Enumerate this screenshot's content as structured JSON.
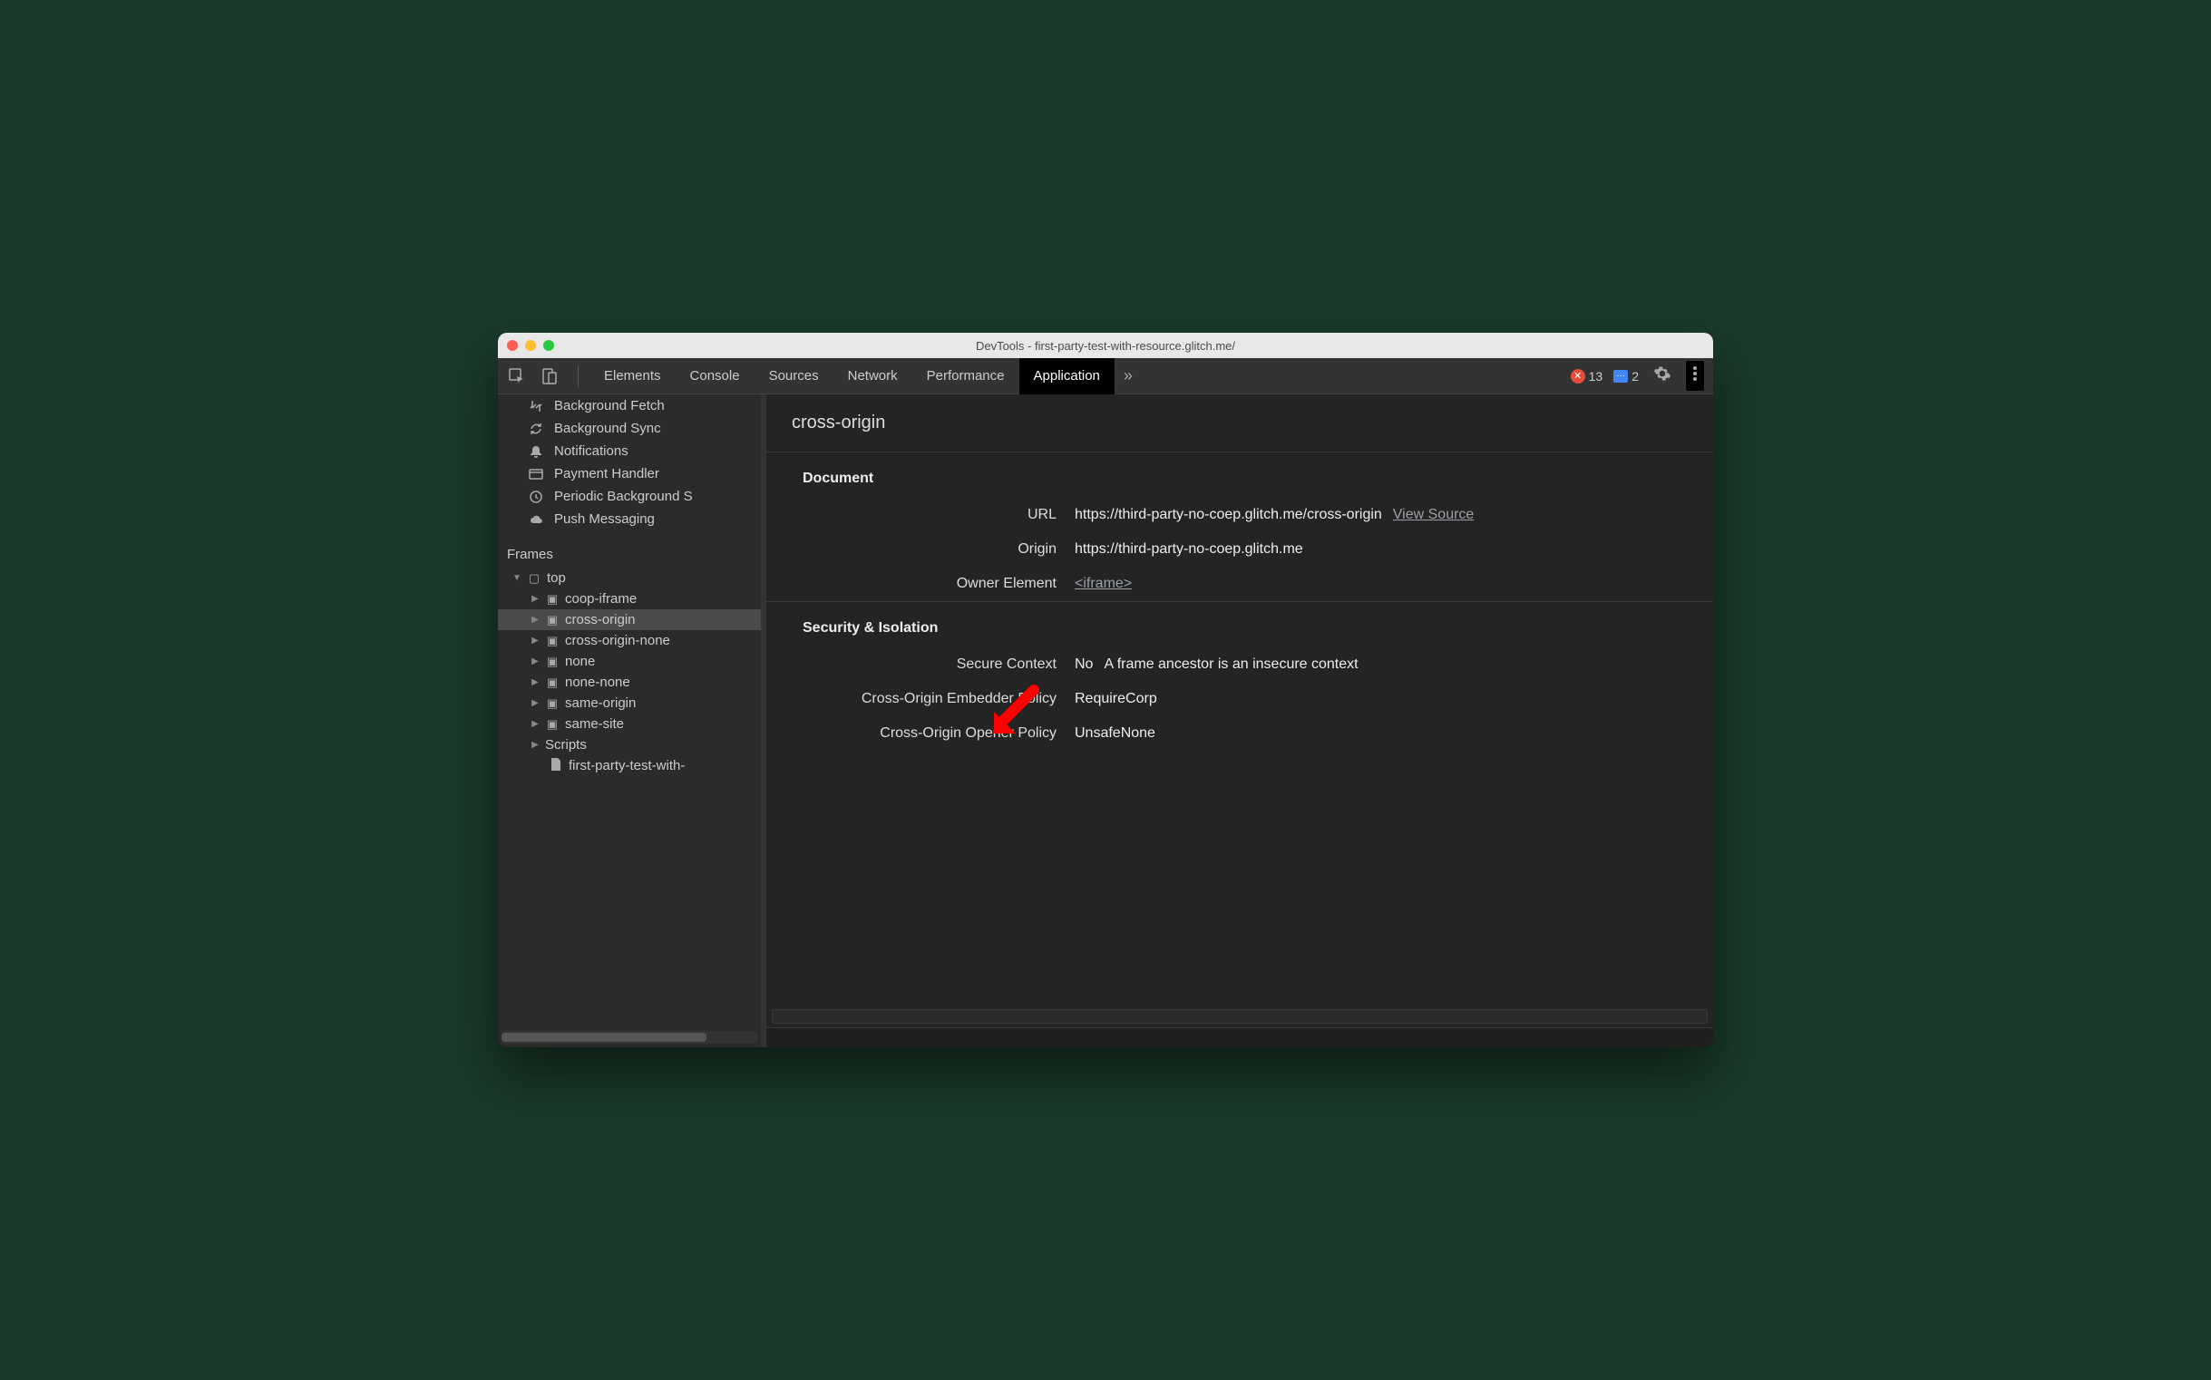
{
  "window": {
    "title": "DevTools - first-party-test-with-resource.glitch.me/"
  },
  "toolbar": {
    "tabs": [
      "Elements",
      "Console",
      "Sources",
      "Network",
      "Performance",
      "Application"
    ],
    "active_tab_index": 5,
    "error_count": "13",
    "info_count": "2"
  },
  "sidebar": {
    "bg_items": [
      {
        "icon": "bgfetch",
        "label": "Background Fetch"
      },
      {
        "icon": "sync",
        "label": "Background Sync"
      },
      {
        "icon": "bell",
        "label": "Notifications"
      },
      {
        "icon": "card",
        "label": "Payment Handler"
      },
      {
        "icon": "clock",
        "label": "Periodic Background S"
      },
      {
        "icon": "cloud",
        "label": "Push Messaging"
      }
    ],
    "frames_label": "Frames",
    "frames": {
      "top": "top",
      "children": [
        "coop-iframe",
        "cross-origin",
        "cross-origin-none",
        "none",
        "none-none",
        "same-origin",
        "same-site"
      ],
      "selected_index": 1,
      "scripts_label": "Scripts",
      "script_file": "first-party-test-with-"
    }
  },
  "main": {
    "title": "cross-origin",
    "document": {
      "heading": "Document",
      "url_key": "URL",
      "url_val": "https://third-party-no-coep.glitch.me/cross-origin",
      "view_source": "View Source",
      "origin_key": "Origin",
      "origin_val": "https://third-party-no-coep.glitch.me",
      "owner_key": "Owner Element",
      "owner_val": "<iframe>"
    },
    "security": {
      "heading": "Security & Isolation",
      "secure_ctx_key": "Secure Context",
      "secure_ctx_val": "No",
      "secure_ctx_msg": "A frame ancestor is an insecure context",
      "coep_key": "Cross-Origin Embedder Policy",
      "coep_val": "RequireCorp",
      "coop_key": "Cross-Origin Opener Policy",
      "coop_val": "UnsafeNone"
    }
  }
}
